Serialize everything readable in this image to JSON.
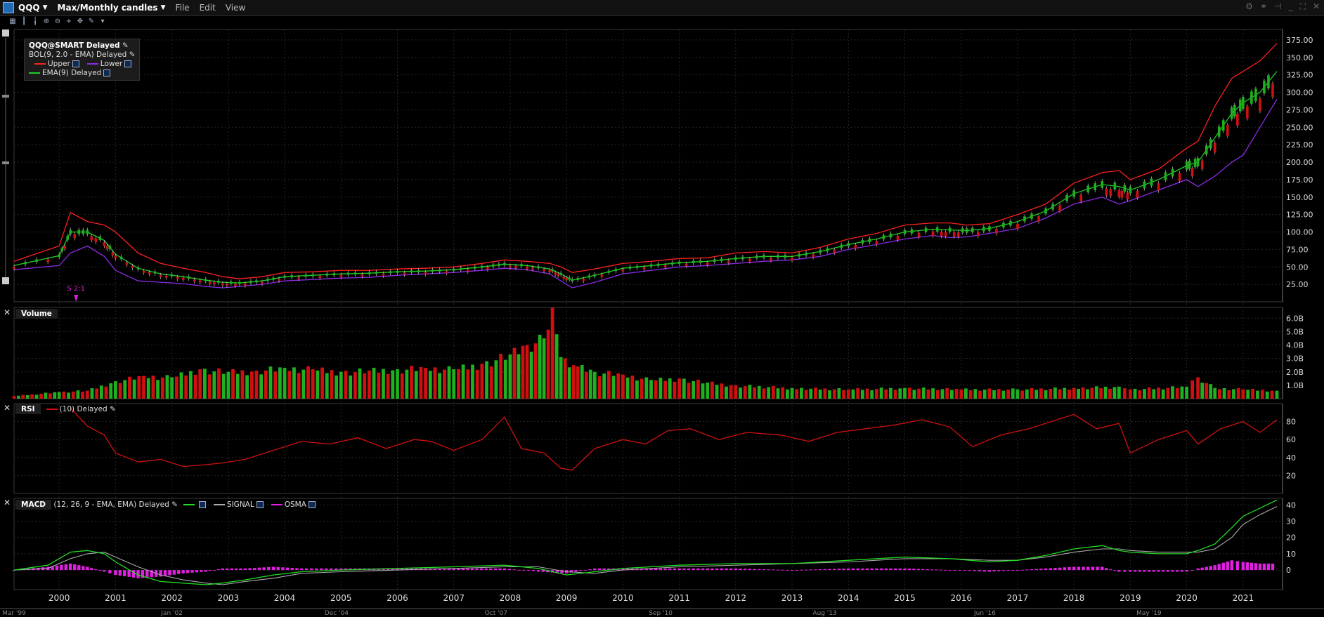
{
  "window": {
    "symbol": "QQQ",
    "timeframe": "Max/Monthly candles",
    "menus": [
      "File",
      "Edit",
      "View"
    ]
  },
  "price_legend": {
    "title": "QQQ@SMART Delayed",
    "bol_label": "BOL(9, 2.0 - EMA) Delayed",
    "upper_label": "Upper",
    "lower_label": "Lower",
    "ema_label": "EMA(9) Delayed"
  },
  "split_marker": "S 2:1",
  "volume_panel": {
    "name": "Volume"
  },
  "rsi_panel": {
    "name": "RSI",
    "params": "(10) Delayed"
  },
  "macd_panel": {
    "name": "MACD",
    "params": "(12, 26, 9 - EMA, EMA) Delayed",
    "signal_label": "SIGNAL",
    "osma_label": "OSMA"
  },
  "colors": {
    "up": "#1fb01f",
    "down": "#d01010",
    "upper_band": "#ff2020",
    "lower_band": "#8a2be2",
    "ema": "#22cc22",
    "rsi": "#d01010",
    "macd": "#22dd22",
    "signal": "#aaaaaa",
    "osma": "#e020e0",
    "background": "#000000",
    "grid": "#262626"
  },
  "chart_data": [
    {
      "type": "line",
      "panel": "price",
      "title": "QQQ@SMART Delayed",
      "yticks": [
        "375.00",
        "350.00",
        "325.00",
        "300.00",
        "275.00",
        "250.00",
        "225.00",
        "200.00",
        "175.00",
        "150.00",
        "125.00",
        "100.00",
        "75.00",
        "50.00",
        "25.00"
      ],
      "ylim": [
        0,
        390
      ],
      "x": [
        1999.2,
        2000.0,
        2000.2,
        2000.5,
        2000.8,
        2001.0,
        2001.4,
        2001.8,
        2002.2,
        2002.6,
        2002.9,
        2003.2,
        2003.6,
        2004.0,
        2004.5,
        2005.0,
        2005.5,
        2006.0,
        2006.5,
        2007.0,
        2007.5,
        2007.9,
        2008.3,
        2008.7,
        2008.9,
        2009.1,
        2009.5,
        2010.0,
        2010.5,
        2011.0,
        2011.5,
        2012.0,
        2012.5,
        2013.0,
        2013.5,
        2014.0,
        2014.5,
        2015.0,
        2015.5,
        2015.8,
        2016.1,
        2016.5,
        2017.0,
        2017.5,
        2018.0,
        2018.5,
        2018.8,
        2019.0,
        2019.5,
        2020.0,
        2020.2,
        2020.5,
        2020.8,
        2021.0,
        2021.3,
        2021.6
      ],
      "series": [
        {
          "name": "Upper",
          "values": [
            58,
            80,
            128,
            115,
            110,
            100,
            70,
            55,
            48,
            42,
            36,
            33,
            36,
            42,
            43,
            45,
            45,
            47,
            48,
            50,
            55,
            60,
            58,
            55,
            50,
            42,
            47,
            55,
            58,
            62,
            63,
            70,
            72,
            70,
            78,
            90,
            98,
            110,
            113,
            113,
            110,
            112,
            125,
            140,
            170,
            185,
            188,
            175,
            190,
            220,
            230,
            280,
            320,
            330,
            345,
            370
          ]
        },
        {
          "name": "Lower",
          "values": [
            46,
            52,
            70,
            80,
            65,
            45,
            30,
            28,
            26,
            22,
            20,
            22,
            25,
            30,
            32,
            34,
            35,
            38,
            40,
            42,
            45,
            48,
            46,
            40,
            30,
            20,
            28,
            40,
            45,
            50,
            52,
            55,
            58,
            60,
            65,
            75,
            82,
            90,
            95,
            92,
            93,
            98,
            105,
            120,
            140,
            150,
            140,
            145,
            160,
            175,
            165,
            180,
            200,
            210,
            250,
            290
          ]
        },
        {
          "name": "EMA(9)",
          "values": [
            52,
            66,
            100,
            100,
            88,
            68,
            48,
            40,
            36,
            31,
            28,
            27,
            30,
            36,
            38,
            40,
            41,
            43,
            44,
            46,
            50,
            54,
            52,
            47,
            40,
            31,
            38,
            48,
            52,
            56,
            58,
            62,
            65,
            65,
            72,
            82,
            90,
            100,
            104,
            103,
            102,
            105,
            115,
            130,
            155,
            168,
            165,
            160,
            175,
            195,
            200,
            235,
            270,
            285,
            300,
            330
          ]
        }
      ]
    },
    {
      "type": "bar",
      "panel": "volume",
      "title": "Volume",
      "yticks": [
        "6.0B",
        "5.0B",
        "4.0B",
        "3.0B",
        "2.0B",
        "1.0B"
      ],
      "ylim": [
        0,
        6.8
      ],
      "x": [
        1999.2,
        2000.0,
        2000.5,
        2001.0,
        2001.5,
        2002.0,
        2002.5,
        2003.0,
        2003.5,
        2004.0,
        2004.5,
        2005.0,
        2005.5,
        2006.0,
        2006.5,
        2007.0,
        2007.5,
        2008.0,
        2008.3,
        2008.6,
        2008.75,
        2008.9,
        2009.2,
        2009.5,
        2010.0,
        2010.5,
        2011.0,
        2011.5,
        2012.0,
        2013.0,
        2014.0,
        2015.0,
        2016.0,
        2017.0,
        2018.0,
        2018.8,
        2019.0,
        2020.0,
        2020.2,
        2020.5,
        2021.0,
        2021.6
      ],
      "values": [
        0.2,
        0.5,
        0.6,
        1.3,
        1.7,
        1.6,
        2.2,
        2.0,
        2.1,
        2.3,
        2.2,
        2.0,
        2.1,
        2.2,
        2.3,
        2.2,
        2.6,
        3.3,
        4.0,
        4.5,
        6.8,
        3.1,
        2.4,
        2.0,
        1.8,
        1.4,
        1.5,
        1.2,
        1.0,
        0.8,
        0.7,
        0.8,
        0.7,
        0.7,
        0.8,
        0.9,
        0.7,
        0.9,
        1.6,
        0.8,
        0.7,
        0.6
      ]
    },
    {
      "type": "line",
      "panel": "rsi",
      "title": "RSI",
      "yticks": [
        "80",
        "60",
        "40",
        "20"
      ],
      "ylim": [
        0,
        100
      ],
      "x": [
        2000.2,
        2000.5,
        2000.8,
        2001.0,
        2001.4,
        2001.8,
        2002.2,
        2002.6,
        2002.9,
        2003.3,
        2003.8,
        2004.3,
        2004.8,
        2005.3,
        2005.8,
        2006.3,
        2006.6,
        2007.0,
        2007.5,
        2007.9,
        2008.2,
        2008.6,
        2008.9,
        2009.1,
        2009.5,
        2010.0,
        2010.4,
        2010.8,
        2011.2,
        2011.7,
        2012.2,
        2012.8,
        2013.3,
        2013.8,
        2014.3,
        2014.8,
        2015.3,
        2015.8,
        2016.2,
        2016.7,
        2017.2,
        2017.7,
        2018.0,
        2018.4,
        2018.8,
        2019.0,
        2019.5,
        2020.0,
        2020.2,
        2020.6,
        2021.0,
        2021.3,
        2021.6
      ],
      "values": [
        95,
        75,
        65,
        45,
        35,
        38,
        30,
        32,
        34,
        38,
        48,
        58,
        55,
        62,
        50,
        60,
        58,
        48,
        60,
        85,
        50,
        45,
        28,
        26,
        50,
        60,
        55,
        70,
        72,
        60,
        68,
        65,
        58,
        68,
        72,
        76,
        82,
        74,
        52,
        65,
        72,
        82,
        88,
        72,
        78,
        45,
        60,
        70,
        55,
        72,
        80,
        68,
        82
      ]
    },
    {
      "type": "line",
      "panel": "macd",
      "title": "MACD",
      "yticks": [
        "40",
        "30",
        "20",
        "10",
        "0"
      ],
      "ylim": [
        -12,
        44
      ],
      "x": [
        1999.2,
        1999.8,
        2000.2,
        2000.5,
        2000.8,
        2001.0,
        2001.4,
        2001.8,
        2002.2,
        2002.6,
        2002.9,
        2003.3,
        2003.8,
        2004.3,
        2005.0,
        2006.0,
        2007.0,
        2007.9,
        2008.5,
        2009.0,
        2009.5,
        2010.0,
        2011.0,
        2012.0,
        2013.0,
        2014.0,
        2015.0,
        2015.8,
        2016.5,
        2017.0,
        2017.5,
        2018.0,
        2018.5,
        2018.8,
        2019.0,
        2019.5,
        2020.0,
        2020.2,
        2020.5,
        2020.8,
        2021.0,
        2021.3,
        2021.6
      ],
      "series": [
        {
          "name": "MACD",
          "values": [
            0,
            3,
            11,
            12,
            10,
            5,
            -3,
            -7,
            -8,
            -9,
            -8,
            -6,
            -3,
            -1,
            0,
            1,
            2,
            3,
            1,
            -3,
            -1,
            1,
            3,
            4,
            4,
            6,
            8,
            7,
            5,
            6,
            9,
            13,
            15,
            12,
            11,
            10,
            10,
            12,
            16,
            26,
            33,
            38,
            43
          ]
        },
        {
          "name": "SIGNAL",
          "values": [
            0,
            1,
            7,
            10,
            11,
            8,
            2,
            -3,
            -6,
            -8,
            -9,
            -7,
            -5,
            -2,
            -1,
            0,
            1,
            2,
            2,
            -1,
            -2,
            0,
            2,
            3,
            4,
            5,
            7,
            7,
            6,
            6,
            8,
            11,
            13,
            13,
            12,
            11,
            11,
            11,
            13,
            20,
            28,
            34,
            39
          ]
        },
        {
          "name": "OSMA",
          "values": [
            0,
            2,
            4,
            2,
            -1,
            -3,
            -5,
            -4,
            -2,
            -1,
            1,
            1,
            2,
            1,
            1,
            1,
            1,
            1,
            -1,
            -2,
            1,
            1,
            1,
            1,
            0,
            1,
            1,
            0,
            -1,
            0,
            1,
            2,
            2,
            -1,
            -1,
            -1,
            -1,
            1,
            3,
            6,
            5,
            4,
            4
          ]
        }
      ]
    }
  ],
  "year_labels": [
    "2000",
    "2001",
    "2002",
    "2003",
    "2004",
    "2005",
    "2006",
    "2007",
    "2008",
    "2009",
    "2010",
    "2011",
    "2012",
    "2013",
    "2014",
    "2015",
    "2016",
    "2017",
    "2018",
    "2019",
    "2020",
    "2021"
  ],
  "date_markers": [
    "Mar '99",
    "Jan '02",
    "Dec '04",
    "Oct '07",
    "Sep '10",
    "Aug '13",
    "Jun '16",
    "May '19"
  ]
}
